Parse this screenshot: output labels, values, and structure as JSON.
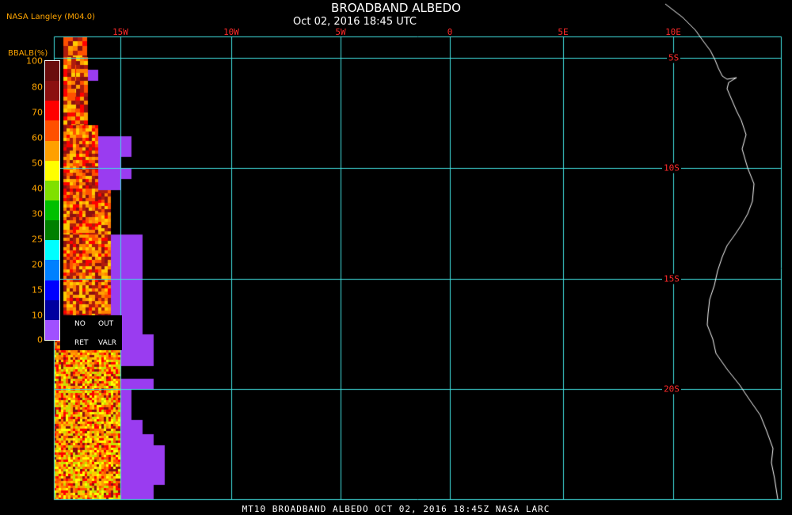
{
  "header": {
    "title": "BROADBAND ALBEDO",
    "subtitle": "Oct 02, 2016 18:45 UTC",
    "credit": "NASA Langley (M04.0)"
  },
  "footer": {
    "text": "MT10  BROADBAND ALBEDO  OCT 02, 2016 18:45Z  NASA LARC"
  },
  "map": {
    "longitudes": [
      "15W",
      "10W",
      "5W",
      "0",
      "5E",
      "10E"
    ],
    "latitudes": [
      "5S",
      "10S",
      "15S",
      "20S"
    ],
    "grid_color": "#40e0e0",
    "label_color": "#ff2a2a",
    "coastline_color": "#ffffff"
  },
  "legend": {
    "title": "BBALB(%)",
    "ticks": [
      "100",
      "80",
      "70",
      "60",
      "50",
      "40",
      "30",
      "25",
      "20",
      "15",
      "10",
      "0"
    ],
    "colors": [
      "#6b0d0d",
      "#8b1010",
      "#ff0000",
      "#ff5000",
      "#ffa000",
      "#ffff00",
      "#80e000",
      "#00c000",
      "#008000",
      "#00ffff",
      "#0080ff",
      "#0000ff",
      "#0000a0",
      "#a050ff"
    ],
    "no_ret_label_1": "NO",
    "no_ret_label_2": "RET",
    "out_valr_label_1": "OUT",
    "out_valr_label_2": "VALR"
  }
}
